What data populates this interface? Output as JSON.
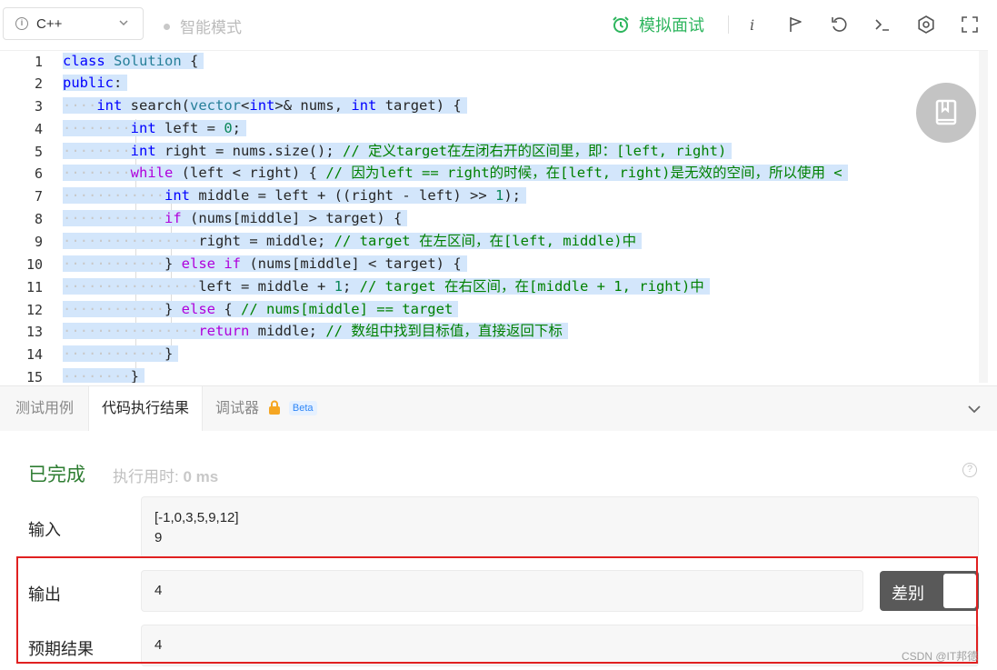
{
  "toolbar": {
    "language": "C++",
    "smart_mode": "智能模式",
    "mock_interview": "模拟面试"
  },
  "editor": {
    "line_numbers": [
      "1",
      "2",
      "3",
      "4",
      "5",
      "6",
      "7",
      "8",
      "9",
      "10",
      "11",
      "12",
      "13",
      "14",
      "15"
    ],
    "code_lines": [
      "class Solution {",
      "public:",
      "    int search(vector<int>& nums, int target) {",
      "        int left = 0;",
      "        int right = nums.size(); // 定义target在左闭右开的区间里，即：[left, right)",
      "        while (left < right) { // 因为left == right的时候，在[left, right)是无效的空间，所以使用 <",
      "            int middle = left + ((right - left) >> 1);",
      "            if (nums[middle] > target) {",
      "                right = middle; // target 在左区间，在[left, middle)中",
      "            } else if (nums[middle] < target) {",
      "                left = middle + 1; // target 在右区间，在[middle + 1, right)中",
      "            } else { // nums[middle] == target",
      "                return middle; // 数组中找到目标值，直接返回下标",
      "            }",
      "        }"
    ]
  },
  "panel": {
    "tabs": [
      "测试用例",
      "代码执行结果",
      "调试器"
    ],
    "beta": "Beta",
    "status": "已完成",
    "runtime_label": "执行用时:",
    "runtime_value": "0 ms",
    "input_label": "输入",
    "input_line1": "[-1,0,3,5,9,12]",
    "input_line2": "9",
    "output_label": "输出",
    "output_value": "4",
    "expected_label": "预期结果",
    "expected_value": "4",
    "diff_label": "差别"
  },
  "watermark": "CSDN @IT邦德",
  "colors": {
    "accent_green": "#2db55d",
    "selection": "#d3e6fb",
    "highlight_red": "#e02020"
  }
}
